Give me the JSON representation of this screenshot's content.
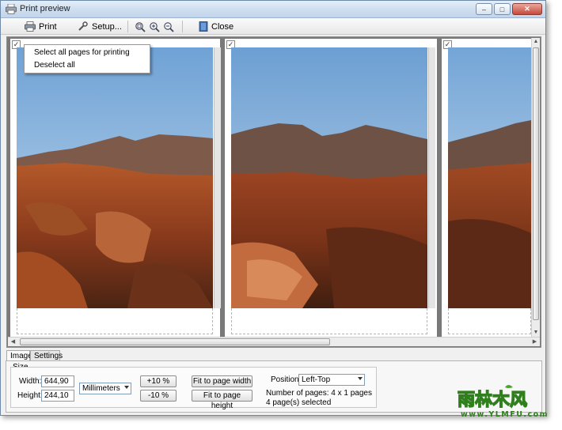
{
  "window": {
    "title": "Print preview"
  },
  "titlebar_buttons": {
    "minimize": "‒",
    "maximize": "□",
    "close": "✕"
  },
  "toolbar": {
    "print_label": "Print",
    "setup_label": "Setup...",
    "close_label": "Close",
    "icons": [
      "printer-icon",
      "setup-wrench-icon",
      "zoom-fit-icon",
      "zoom-in-icon",
      "zoom-out-icon",
      "close-door-icon"
    ]
  },
  "preview": {
    "pages_count_visible": 3,
    "check_mark": "✓"
  },
  "context_menu": {
    "items": [
      "Select all pages for printing",
      "Deselect all"
    ]
  },
  "tabs": [
    {
      "label": "Image",
      "active": true
    },
    {
      "label": "Settings",
      "active": false
    }
  ],
  "image_settings": {
    "size_label": "Size",
    "width_label": "Width:",
    "width_value": "644,90",
    "height_label": "Height:",
    "height_value": "244,10",
    "units_selected": "Millimeters",
    "plus_button": "+10 %",
    "minus_button": "-10 %",
    "fit_width_button": "Fit to page width",
    "fit_height_button": "Fit to page height",
    "position_label": "Position:",
    "position_selected": "Left-Top",
    "pages_info": "Number of pages: 4 x 1 pages",
    "selected_info": "4 page(s) selected"
  },
  "watermark": {
    "text": "雨林木风",
    "url": "www.YLMFU.com"
  },
  "colors": {
    "titlebar": "#cfdff0",
    "preview_bg": "#7a7a7a",
    "sky": "#9dc3e8",
    "terrain": "#a8532a",
    "watermark_green": "#4aa52b"
  }
}
